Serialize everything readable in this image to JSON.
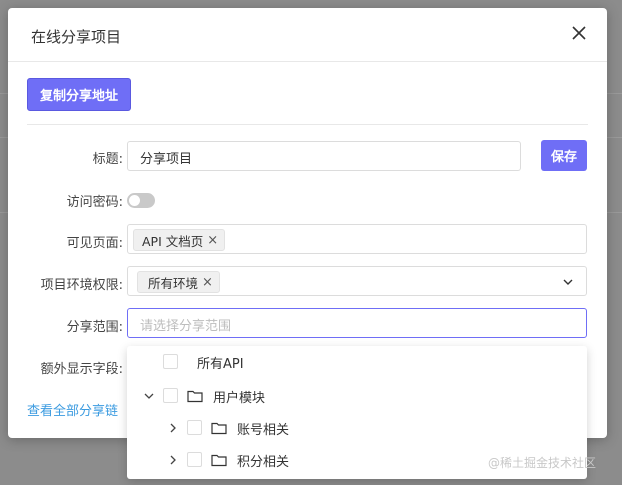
{
  "modal": {
    "title": "在线分享项目",
    "copy_button": "复制分享地址",
    "save_button": "保存"
  },
  "form": {
    "title_label": "标题:",
    "title_value": "分享项目",
    "password_label": "访问密码:",
    "password_enabled": false,
    "visible_pages_label": "可见页面:",
    "visible_pages_tags": [
      "API 文档页"
    ],
    "env_label": "项目环境权限:",
    "env_tags": [
      "所有环境"
    ],
    "scope_label": "分享范围:",
    "scope_placeholder": "请选择分享范围",
    "extra_fields_label": "额外显示字段:"
  },
  "link": {
    "view_all": "查看全部分享链"
  },
  "tree": {
    "items": [
      {
        "label": "所有API",
        "level": 0,
        "expandable": false,
        "folder": false,
        "checked": false
      },
      {
        "label": "用户模块",
        "level": 0,
        "expandable": true,
        "expanded": true,
        "folder": true,
        "checked": false
      },
      {
        "label": "账号相关",
        "level": 1,
        "expandable": true,
        "expanded": false,
        "folder": true,
        "checked": false
      },
      {
        "label": "积分相关",
        "level": 1,
        "expandable": true,
        "expanded": false,
        "folder": true,
        "checked": false
      }
    ]
  },
  "watermark": "@稀土掘金技术社区",
  "colors": {
    "primary": "#6f6ef6",
    "link": "#3b9be0",
    "overlay": "#8c8c8c"
  },
  "tag_close_glyph": "×"
}
